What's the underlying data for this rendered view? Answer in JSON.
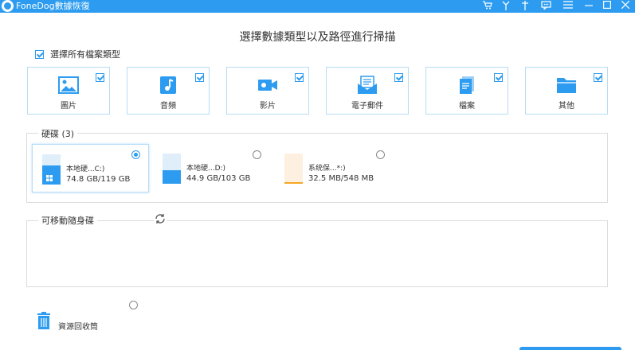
{
  "window": {
    "title": "FoneDog數據恢復",
    "accent_color": "#2d9cf0",
    "toolbar_icons": [
      "cart-icon",
      "key-icon",
      "pin-icon",
      "chat-icon",
      "menu-icon",
      "minimize-icon",
      "maximize-icon",
      "close-icon"
    ]
  },
  "main": {
    "heading": "選擇數據類型以及路徑進行掃描"
  },
  "select_all": {
    "label": "選擇所有檔案類型",
    "checked": true
  },
  "file_types": [
    {
      "label": "圖片",
      "icon": "image-icon",
      "checked": true
    },
    {
      "label": "音頻",
      "icon": "music-icon",
      "checked": true
    },
    {
      "label": "影片",
      "icon": "video-icon",
      "checked": true
    },
    {
      "label": "電子郵件",
      "icon": "mail-icon",
      "checked": true
    },
    {
      "label": "檔案",
      "icon": "document-icon",
      "checked": true
    },
    {
      "label": "其他",
      "icon": "folder-icon",
      "checked": true
    }
  ],
  "hard_disk": {
    "title": "硬碟 (3)",
    "drives": [
      {
        "name": "本地硬...C:)",
        "size": "74.8 GB/119 GB",
        "used_fraction": 0.63,
        "selected": true,
        "icon": "windows-drive-icon"
      },
      {
        "name": "本地硬...D:)",
        "size": "44.9 GB/103 GB",
        "used_fraction": 0.44,
        "selected": false,
        "icon": "drive-icon"
      },
      {
        "name": "系统保...*:)",
        "size": "32.5 MB/548 MB",
        "used_fraction": 0.06,
        "selected": false,
        "icon": "drive-icon",
        "fill_color": "#f5a623"
      }
    ]
  },
  "removable": {
    "title": "可移動隨身碟"
  },
  "recycle_bin": {
    "label": "資源回收筒",
    "selected": false
  }
}
